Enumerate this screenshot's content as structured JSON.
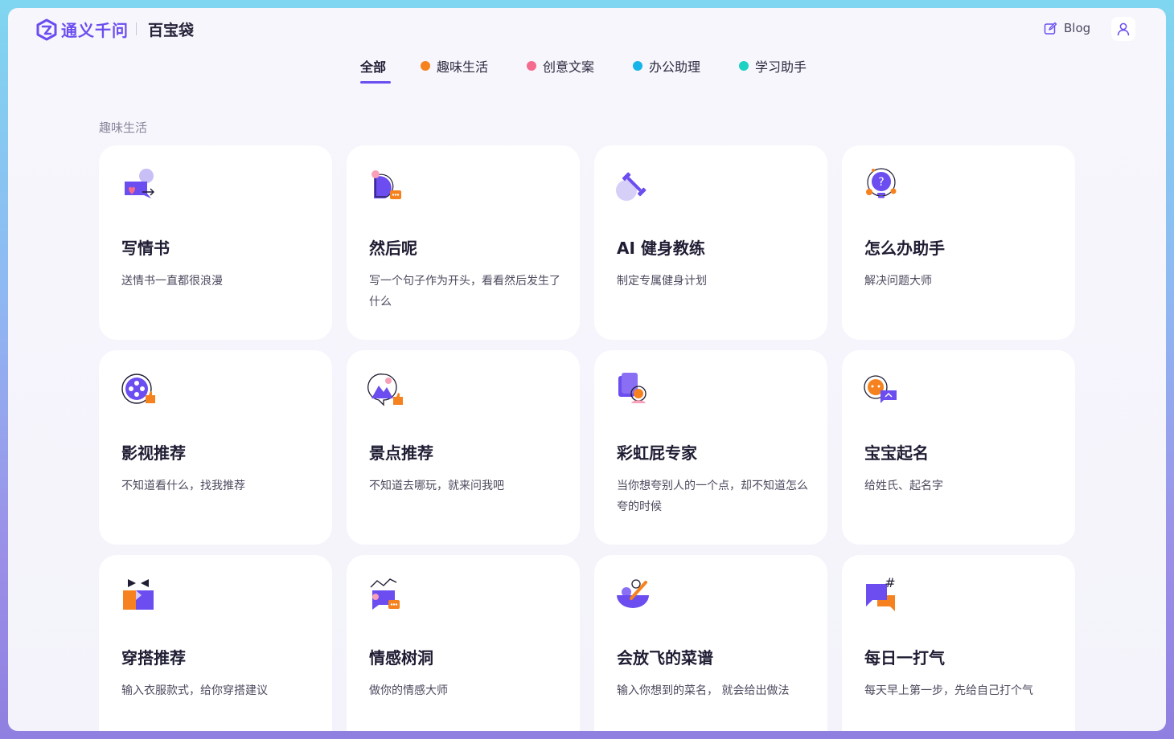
{
  "header": {
    "brand": "通义千问",
    "product": "百宝袋",
    "blog_label": "Blog"
  },
  "tabs": [
    {
      "label": "全部",
      "active": true,
      "dot_color": null
    },
    {
      "label": "趣味生活",
      "active": false,
      "dot_color": "#f5821f"
    },
    {
      "label": "创意文案",
      "active": false,
      "dot_color": "#f56b8d"
    },
    {
      "label": "办公助理",
      "active": false,
      "dot_color": "#16b4e8"
    },
    {
      "label": "学习助手",
      "active": false,
      "dot_color": "#1bd1c4"
    }
  ],
  "section": {
    "title": "趣味生活"
  },
  "cards": [
    {
      "title": "写情书",
      "desc": "送情书一直都很浪漫",
      "icon": "love-letter-icon"
    },
    {
      "title": "然后呢",
      "desc": "写一个句子作为开头，看看然后发生了什么",
      "icon": "chat-bubble-icon"
    },
    {
      "title": "AI 健身教练",
      "desc": "制定专属健身计划",
      "icon": "dumbbell-icon"
    },
    {
      "title": "怎么办助手",
      "desc": "解决问题大师",
      "icon": "lightbulb-question-icon"
    },
    {
      "title": "影视推荐",
      "desc": "不知道看什么，找我推荐",
      "icon": "film-reel-icon"
    },
    {
      "title": "景点推荐",
      "desc": "不知道去哪玩，就来问我吧",
      "icon": "location-pin-icon"
    },
    {
      "title": "彩虹屁专家",
      "desc": "当你想夸别人的一个点，却不知道怎么夸的时候",
      "icon": "praise-icon"
    },
    {
      "title": "宝宝起名",
      "desc": "给姓氏、起名字",
      "icon": "baby-name-icon"
    },
    {
      "title": "穿搭推荐",
      "desc": "输入衣服款式，给你穿搭建议",
      "icon": "outfit-icon"
    },
    {
      "title": "情感树洞",
      "desc": "做你的情感大师",
      "icon": "emotion-chat-icon"
    },
    {
      "title": "会放飞的菜谱",
      "desc": "输入你想到的菜名， 就会给出做法",
      "icon": "recipe-bowl-icon"
    },
    {
      "title": "每日一打气",
      "desc": "每天早上第一步，先给自己打个气",
      "icon": "hashtag-chat-icon"
    }
  ],
  "colors": {
    "accent": "#6b4df0",
    "orange": "#f5821f",
    "pink": "#f56b8d",
    "cyan": "#16b4e8",
    "teal": "#1bd1c4"
  }
}
